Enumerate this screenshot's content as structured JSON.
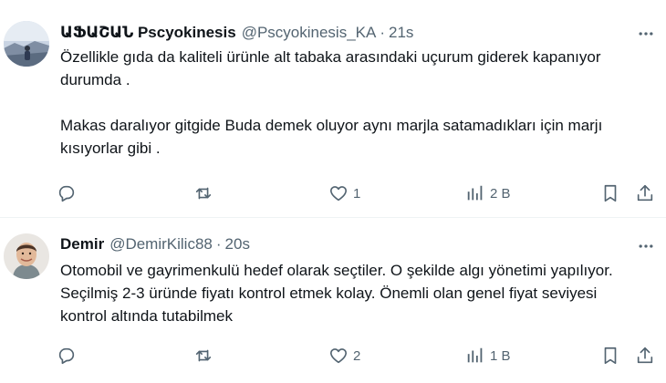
{
  "tweets": [
    {
      "author_name": "ԱՖԱՇԱՆ Pscyokinesis",
      "handle": "@Pscyokinesis_KA",
      "separator": "·",
      "time": "21s",
      "text": "Özellikle gıda da kaliteli ürünle alt tabaka arasındaki uçurum giderek kapanıyor durumda .\n\nMakas daralıyor gitgide Buda demek oluyor aynı marjla satamadıkları için marjı kısıyorlar  gibi .",
      "replies": "",
      "retweets": "",
      "likes": "1",
      "views": "2 B",
      "icons": [
        "more-icon",
        "reply-icon",
        "retweet-icon",
        "heart-icon",
        "views-icon",
        "bookmark-icon",
        "share-icon"
      ]
    },
    {
      "author_name": "Demir",
      "handle": "@DemirKilic88",
      "separator": "·",
      "time": "20s",
      "text": "Otomobil ve gayrimenkulü hedef olarak seçtiler. O şekilde algı yönetimi yapılıyor. Seçilmiş 2-3 üründe fiyatı kontrol etmek kolay. Önemli olan genel fiyat seviyesi kontrol altında tutabilmek",
      "replies": "",
      "retweets": "",
      "likes": "2",
      "views": "1 B"
    }
  ],
  "colors": {
    "text_primary": "#0f1419",
    "text_secondary": "#536471",
    "divider": "#eff3f4"
  }
}
